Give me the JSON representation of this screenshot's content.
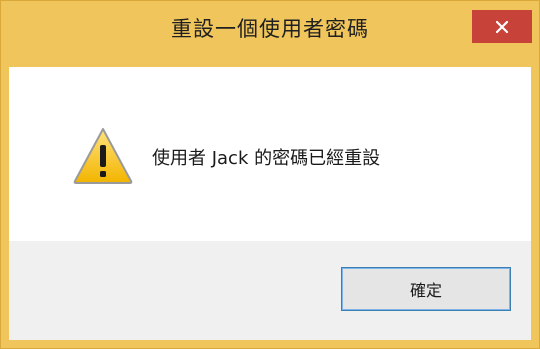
{
  "window": {
    "title": "重設一個使用者密碼"
  },
  "message": {
    "text": "使用者 Jack 的密碼已經重設",
    "icon": "warning-icon"
  },
  "buttons": {
    "close_icon": "close-icon",
    "ok_label": "確定"
  },
  "colors": {
    "frame": "#f0c55c",
    "close_button": "#c7433a",
    "footer": "#f0f0f0",
    "ok_border": "#3c7fb1"
  }
}
